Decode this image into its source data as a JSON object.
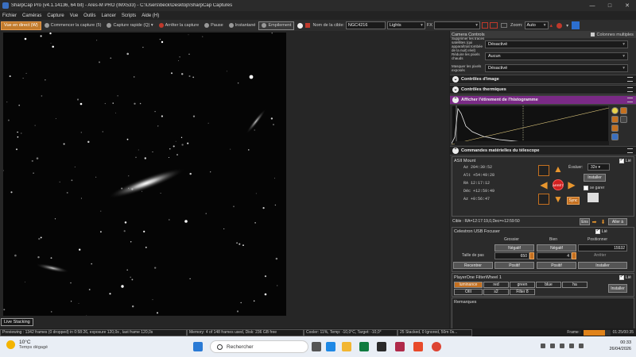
{
  "window": {
    "title": "SharpCap Pro (v4.1.14136, 64 bit) - Ares-M PRO (IMX533) - C:\\Users\\beck\\Desktop\\SharpCap Captures",
    "minimize": "—",
    "maximize": "□",
    "close": "✕"
  },
  "menu": [
    "Fichier",
    "Caméras",
    "Capture",
    "Vue",
    "Outils",
    "Lancer",
    "Scripts",
    "Aide (H)"
  ],
  "toolbar": {
    "live": "Vue en direct (W)",
    "start_capture": "Commencer la capture (5)",
    "quick_capture": "Capture rapide (Q)",
    "stop_capture": "Arrêter la capture",
    "pause": "Pause",
    "snapshot": "Instantané",
    "stacking": "Empilement",
    "target_label": "Nom de la cible:",
    "target_value": "NGC4216",
    "frame_type": "Lights",
    "fx_label": "FX",
    "zoom_label": "Zoom:",
    "zoom_value": "Auto"
  },
  "image": {
    "live_stacking_button": "Live Stacking"
  },
  "status_bar": {
    "preview": "Previewing : 1342 frames (0 dropped) in 0:58:26, exposure 120,0s , last frame 120,0s",
    "memory": "Memory: 4 of 148 frames used, Disk: 236 GB free",
    "cooler": "Cooler: 11%, Temp: -10,0°C, Target: -10,0°",
    "stack": "25 Stacked, 0 Ignored, 50m 0s...",
    "frame_label": "Frame :",
    "frame_time": "01:25/00:35",
    "frame_progress": 0.8
  },
  "panel": {
    "header": "Camera Controls",
    "multi_columns": "Colonnes multiples",
    "rows": [
      {
        "label": "Supprimer les traces satellites (qui apparaîtrait tombée de la nuit) réel)",
        "value": "Désactivé"
      },
      {
        "label": "Réduire les pixels chauds",
        "value": "Aucun"
      },
      {
        "label": "Masquer les pixels exposés",
        "value": "Désactivé"
      }
    ],
    "sections": {
      "image_controls": "Contrôles d'image",
      "thermal_controls": "Contrôles thermiques",
      "histogram": "Afficher l'étirement de l'histogramme",
      "telescope": "Commandes matérielles du télescope"
    },
    "mount": {
      "name": "ASII Mount",
      "linked": "Lié",
      "az": "Az   204:30:52",
      "alt": "Alt  +54:49:28",
      "ra": "RA     12:17:12",
      "dec": "Déc  +12:59:49",
      "az2": "Az   +0:56:47",
      "evaluate_label": "Évaluer:",
      "rate": "32x",
      "install": "Installer",
      "park": "se garer",
      "stop": "ARRÊT",
      "sync": "Sync",
      "target_line": "Cible : RA=12:17:19,0,Dec=+12:59:50",
      "ens": "Ens",
      "goto": "Aller à"
    },
    "focuser": {
      "name": "Celestron USB Focuser",
      "linked": "Lié",
      "coarse": "Grossier",
      "fine": "Bien",
      "position": "Positionner",
      "negative": "Négatif",
      "positive": "Positif",
      "position_value": "15532",
      "step_label": "Taille de pas",
      "coarse_step": "650",
      "fine_step": "4",
      "stop": "Arrêter",
      "recenter": "Recentrer",
      "install": "Installer"
    },
    "filterwheel": {
      "name": "PlayerOne FilterWheel 1",
      "linked": "Lié",
      "filters": [
        "luminance",
        "red",
        "green",
        "blue",
        "ha",
        "OIII",
        "s2",
        "Filter 8"
      ],
      "selected": "luminance",
      "install": "Installer"
    },
    "remarks": "Remarques"
  },
  "taskbar": {
    "temp": "10°C",
    "weather": "Temps dégagé",
    "search": "Rechercher",
    "time": "00:33",
    "date": "26/04/2026"
  }
}
